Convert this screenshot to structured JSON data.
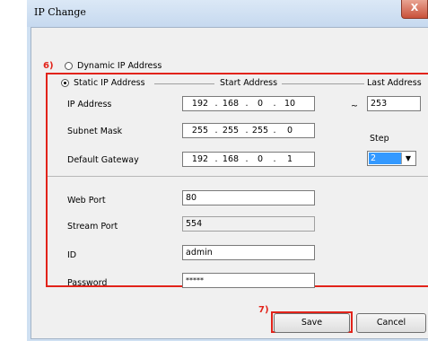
{
  "window": {
    "title": "IP Change",
    "close_label": "X"
  },
  "annotations": {
    "group_marker": "6)",
    "save_marker": "7)"
  },
  "mode": {
    "dynamic_label": "Dynamic IP Address",
    "static_label": "Static IP Address",
    "selected": "static"
  },
  "columns": {
    "start_address": "Start Address",
    "last_address": "Last Address"
  },
  "ip_settings": {
    "ip_address": {
      "label": "IP Address",
      "segments": [
        "192",
        "168",
        "0",
        "10"
      ]
    },
    "subnet_mask": {
      "label": "Subnet Mask",
      "segments": [
        "255",
        "255",
        "255",
        "0"
      ]
    },
    "default_gateway": {
      "label": "Default Gateway",
      "segments": [
        "192",
        "168",
        "0",
        "1"
      ]
    },
    "range_separator": "~",
    "last_address_value": "253",
    "step_label": "Step",
    "step_value": "2"
  },
  "ports": {
    "web_port": {
      "label": "Web Port",
      "value": "80"
    },
    "stream_port": {
      "label": "Stream Port",
      "value": "554"
    },
    "id": {
      "label": "ID",
      "value": "admin"
    },
    "password": {
      "label": "Password",
      "value": "*****"
    }
  },
  "buttons": {
    "save": "Save",
    "cancel": "Cancel"
  },
  "colors": {
    "annotation_red": "#e2231a",
    "title_bg": "#cfe0f2",
    "dialog_bg": "#f0f0f0",
    "selection_blue": "#3399ff"
  }
}
